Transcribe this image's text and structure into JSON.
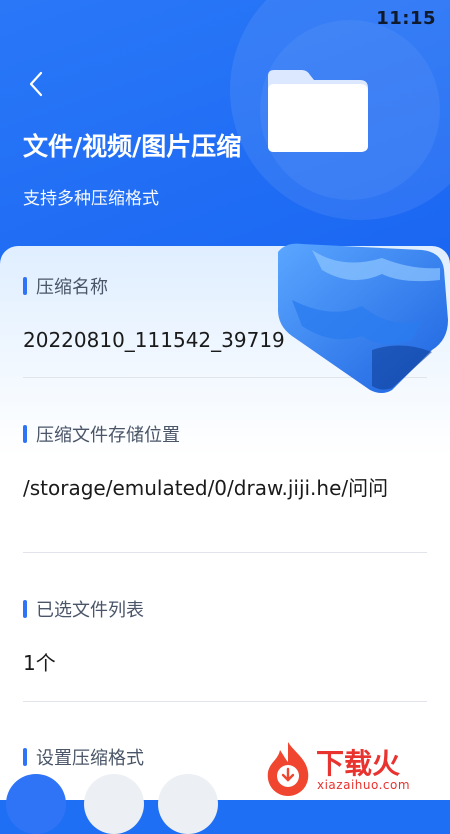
{
  "status": {
    "time": "11:15"
  },
  "header": {
    "back_icon": "chevron-left-icon",
    "title": "文件/视频/图片压缩",
    "subtitle": "支持多种压缩格式",
    "illustration": "folder-icon"
  },
  "form": {
    "name_label": "压缩名称",
    "name_value": "20220810_111542_39719",
    "path_label": "压缩文件存储位置",
    "path_value": "/storage/emulated/0/draw.jiji.he/问问",
    "files_label": "已选文件列表",
    "files_value": "1个",
    "format_label": "设置压缩格式"
  },
  "watermark": {
    "text": "下载火",
    "sub": "xiazaihuo.com"
  },
  "colors": {
    "primary": "#1f6ff5",
    "accent_bar": "#2f74f6",
    "watermark": "#e8332e"
  }
}
